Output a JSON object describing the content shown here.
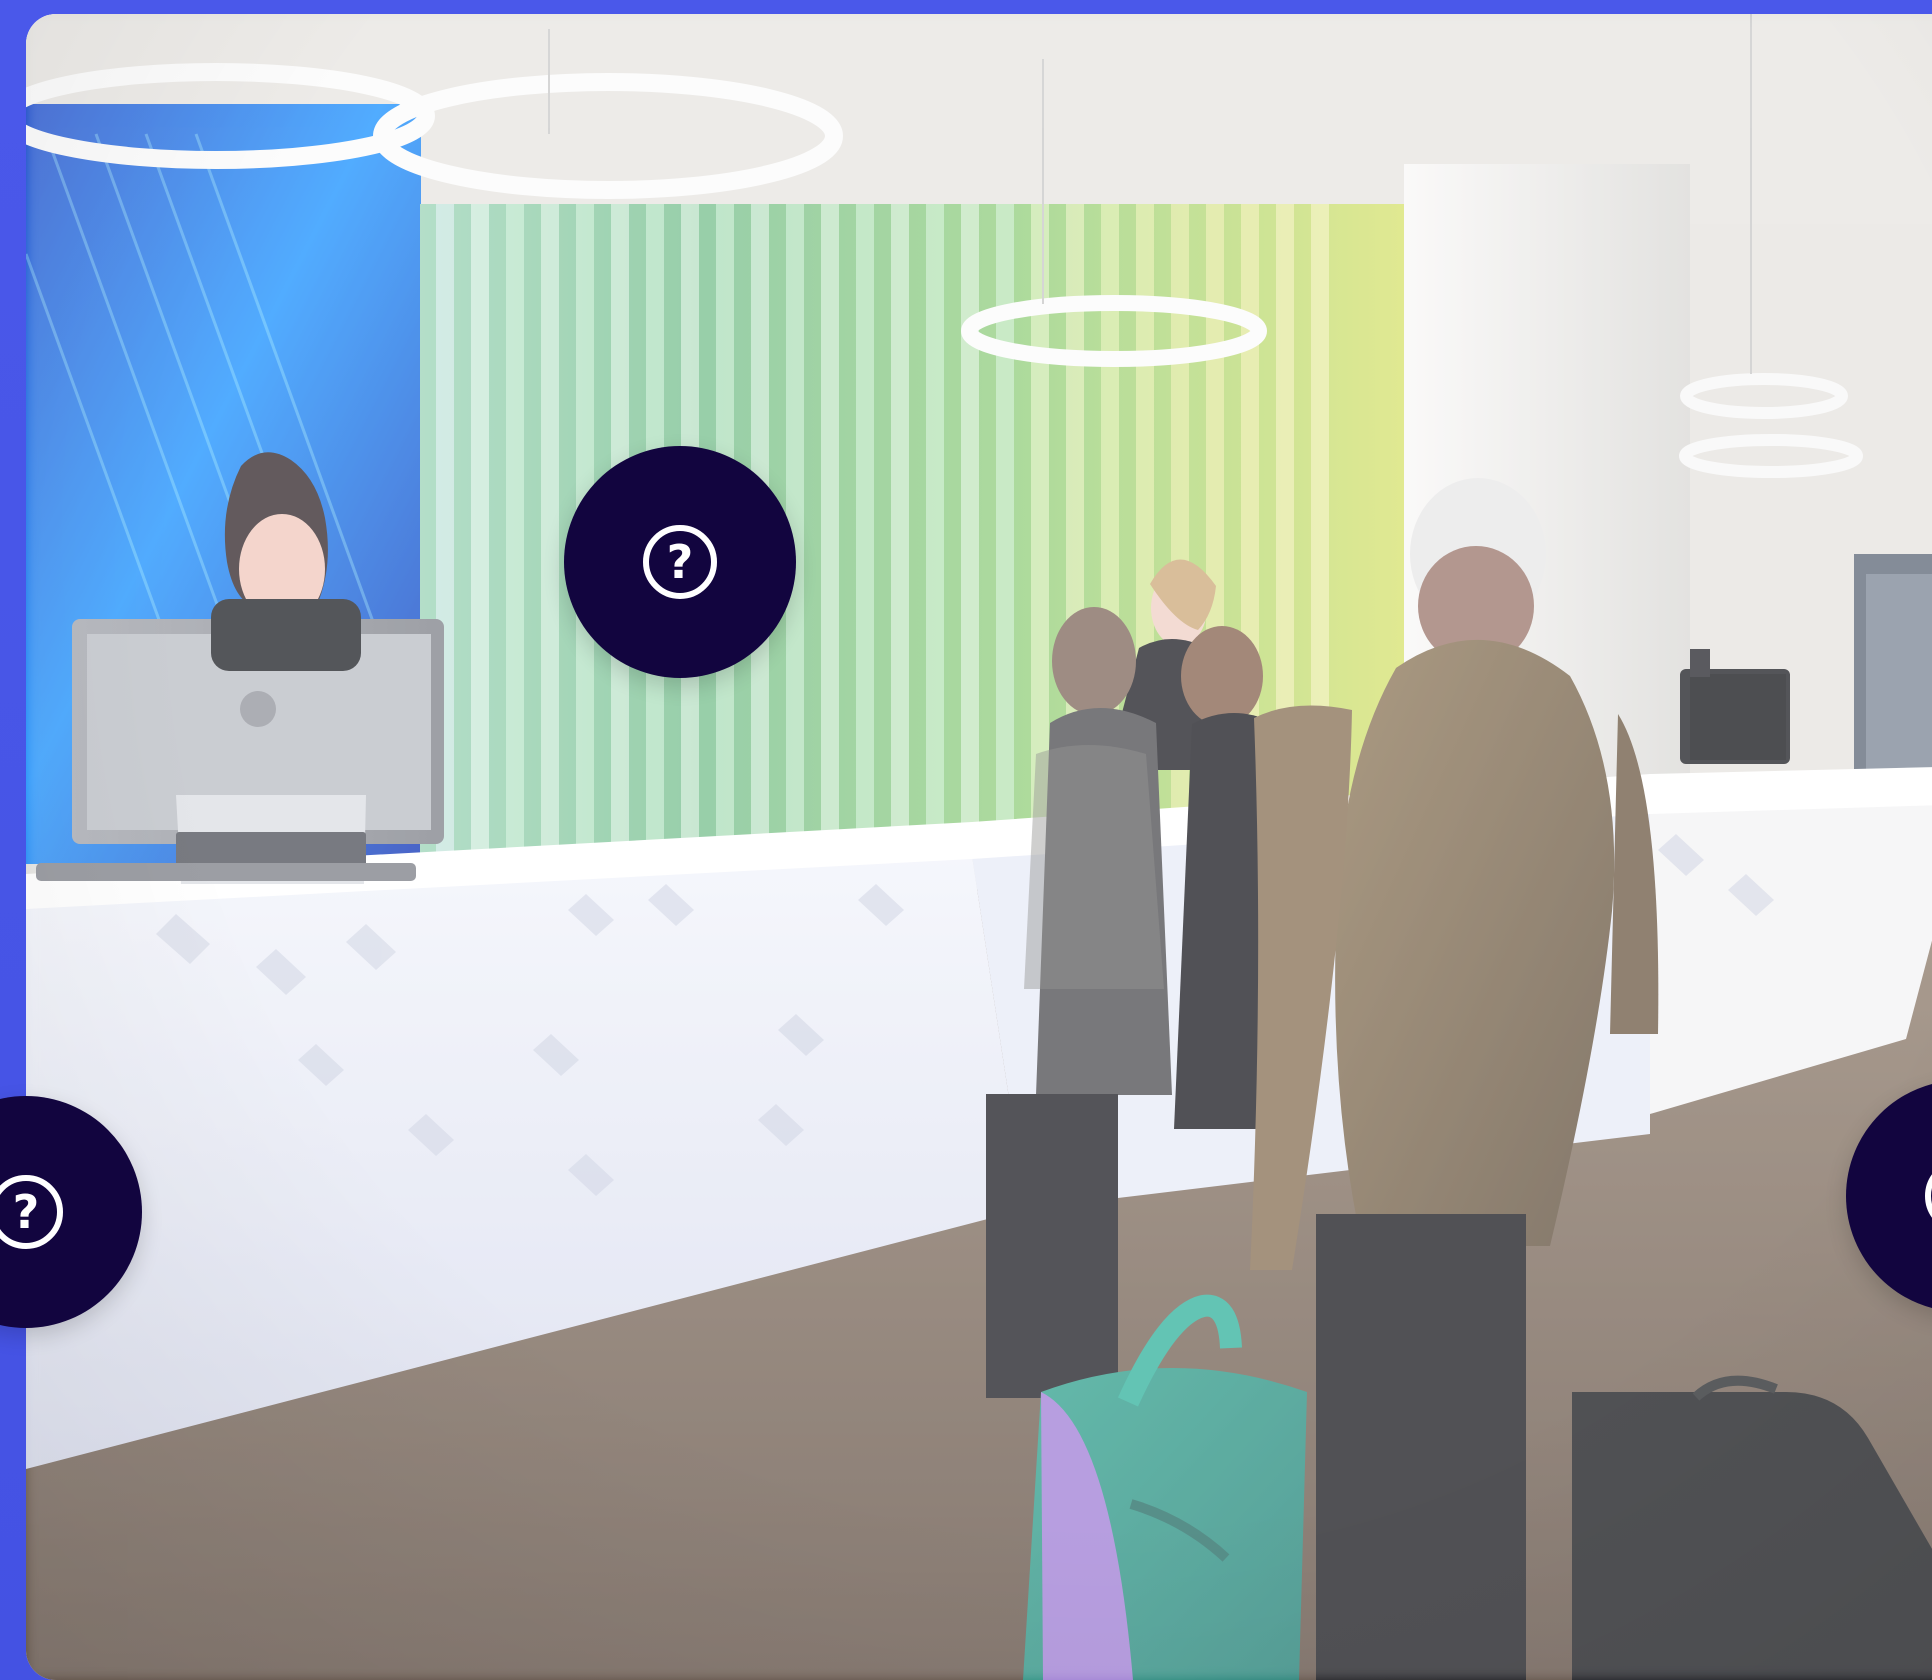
{
  "ui": {
    "background_color": "#4b54e6",
    "hotspot_color": "#12053f"
  },
  "scene": {
    "name": "hotel-reception-photo"
  },
  "hotspots": [
    {
      "name": "help-hotspot-center",
      "glyph": "?",
      "icon": "question-circle-icon"
    },
    {
      "name": "help-hotspot-left",
      "glyph": "?",
      "icon": "question-circle-icon"
    },
    {
      "name": "help-hotspot-right",
      "glyph": "?",
      "icon": "question-circle-icon"
    }
  ]
}
